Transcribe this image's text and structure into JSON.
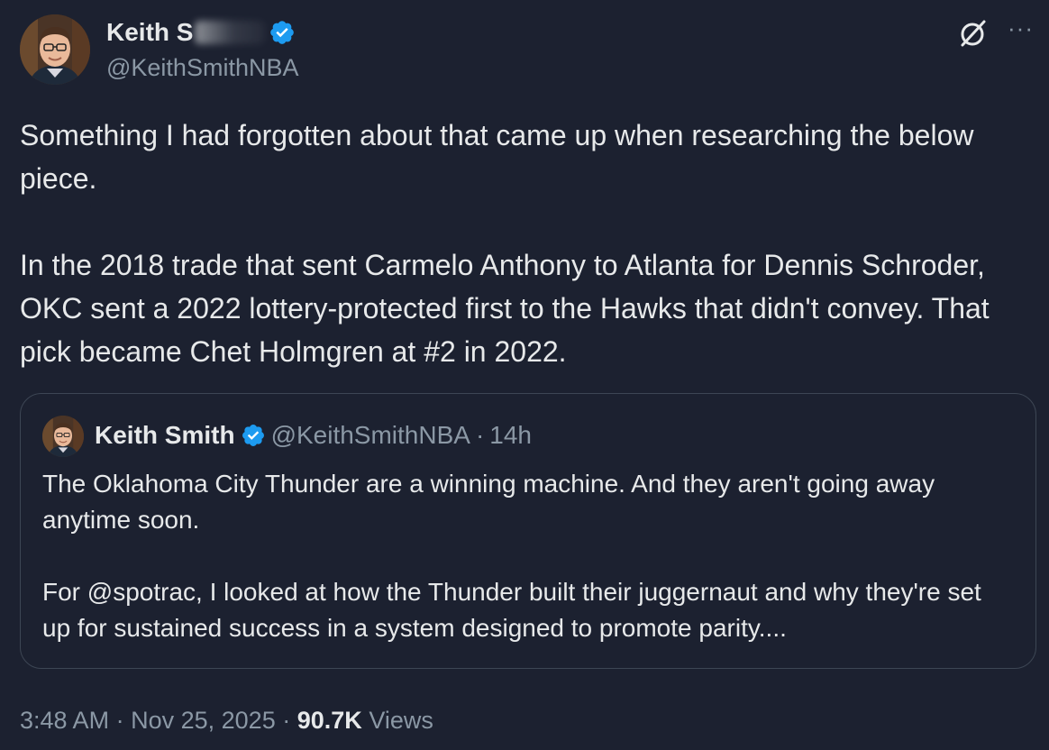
{
  "author": {
    "display_name": "Keith S",
    "handle": "@KeithSmithNBA"
  },
  "tweet": {
    "paragraph_1": "Something I had forgotten about that came up when researching the below piece.",
    "paragraph_2": "In the 2018 trade that sent Carmelo Anthony to Atlanta for Dennis Schroder, OKC sent a 2022 lottery-protected first to the Hawks that didn't convey. That pick became Chet Holmgren at #2 in 2022."
  },
  "quoted_tweet": {
    "display_name": "Keith Smith",
    "handle": "@KeithSmithNBA",
    "separator": "·",
    "time": "14h",
    "paragraph_1": "The Oklahoma City Thunder are a winning machine. And they aren't going away anytime soon.",
    "paragraph_2": "For @spotrac, I looked at how the Thunder built their juggernaut and why they're set up for sustained success in a system designed to promote parity...."
  },
  "meta": {
    "time": "3:48 AM",
    "separator": "·",
    "date": "Nov 25, 2025",
    "views_count": "90.7K",
    "views_label": "Views"
  },
  "icons": {
    "verified": "verified-badge-icon",
    "grok": "grok-icon",
    "more": "more-options-icon"
  },
  "colors": {
    "background": "#1c2130",
    "text_primary": "#e7e9ea",
    "text_secondary": "#8b98a5",
    "verified_blue": "#1d9bf0",
    "border": "#3d4654"
  }
}
